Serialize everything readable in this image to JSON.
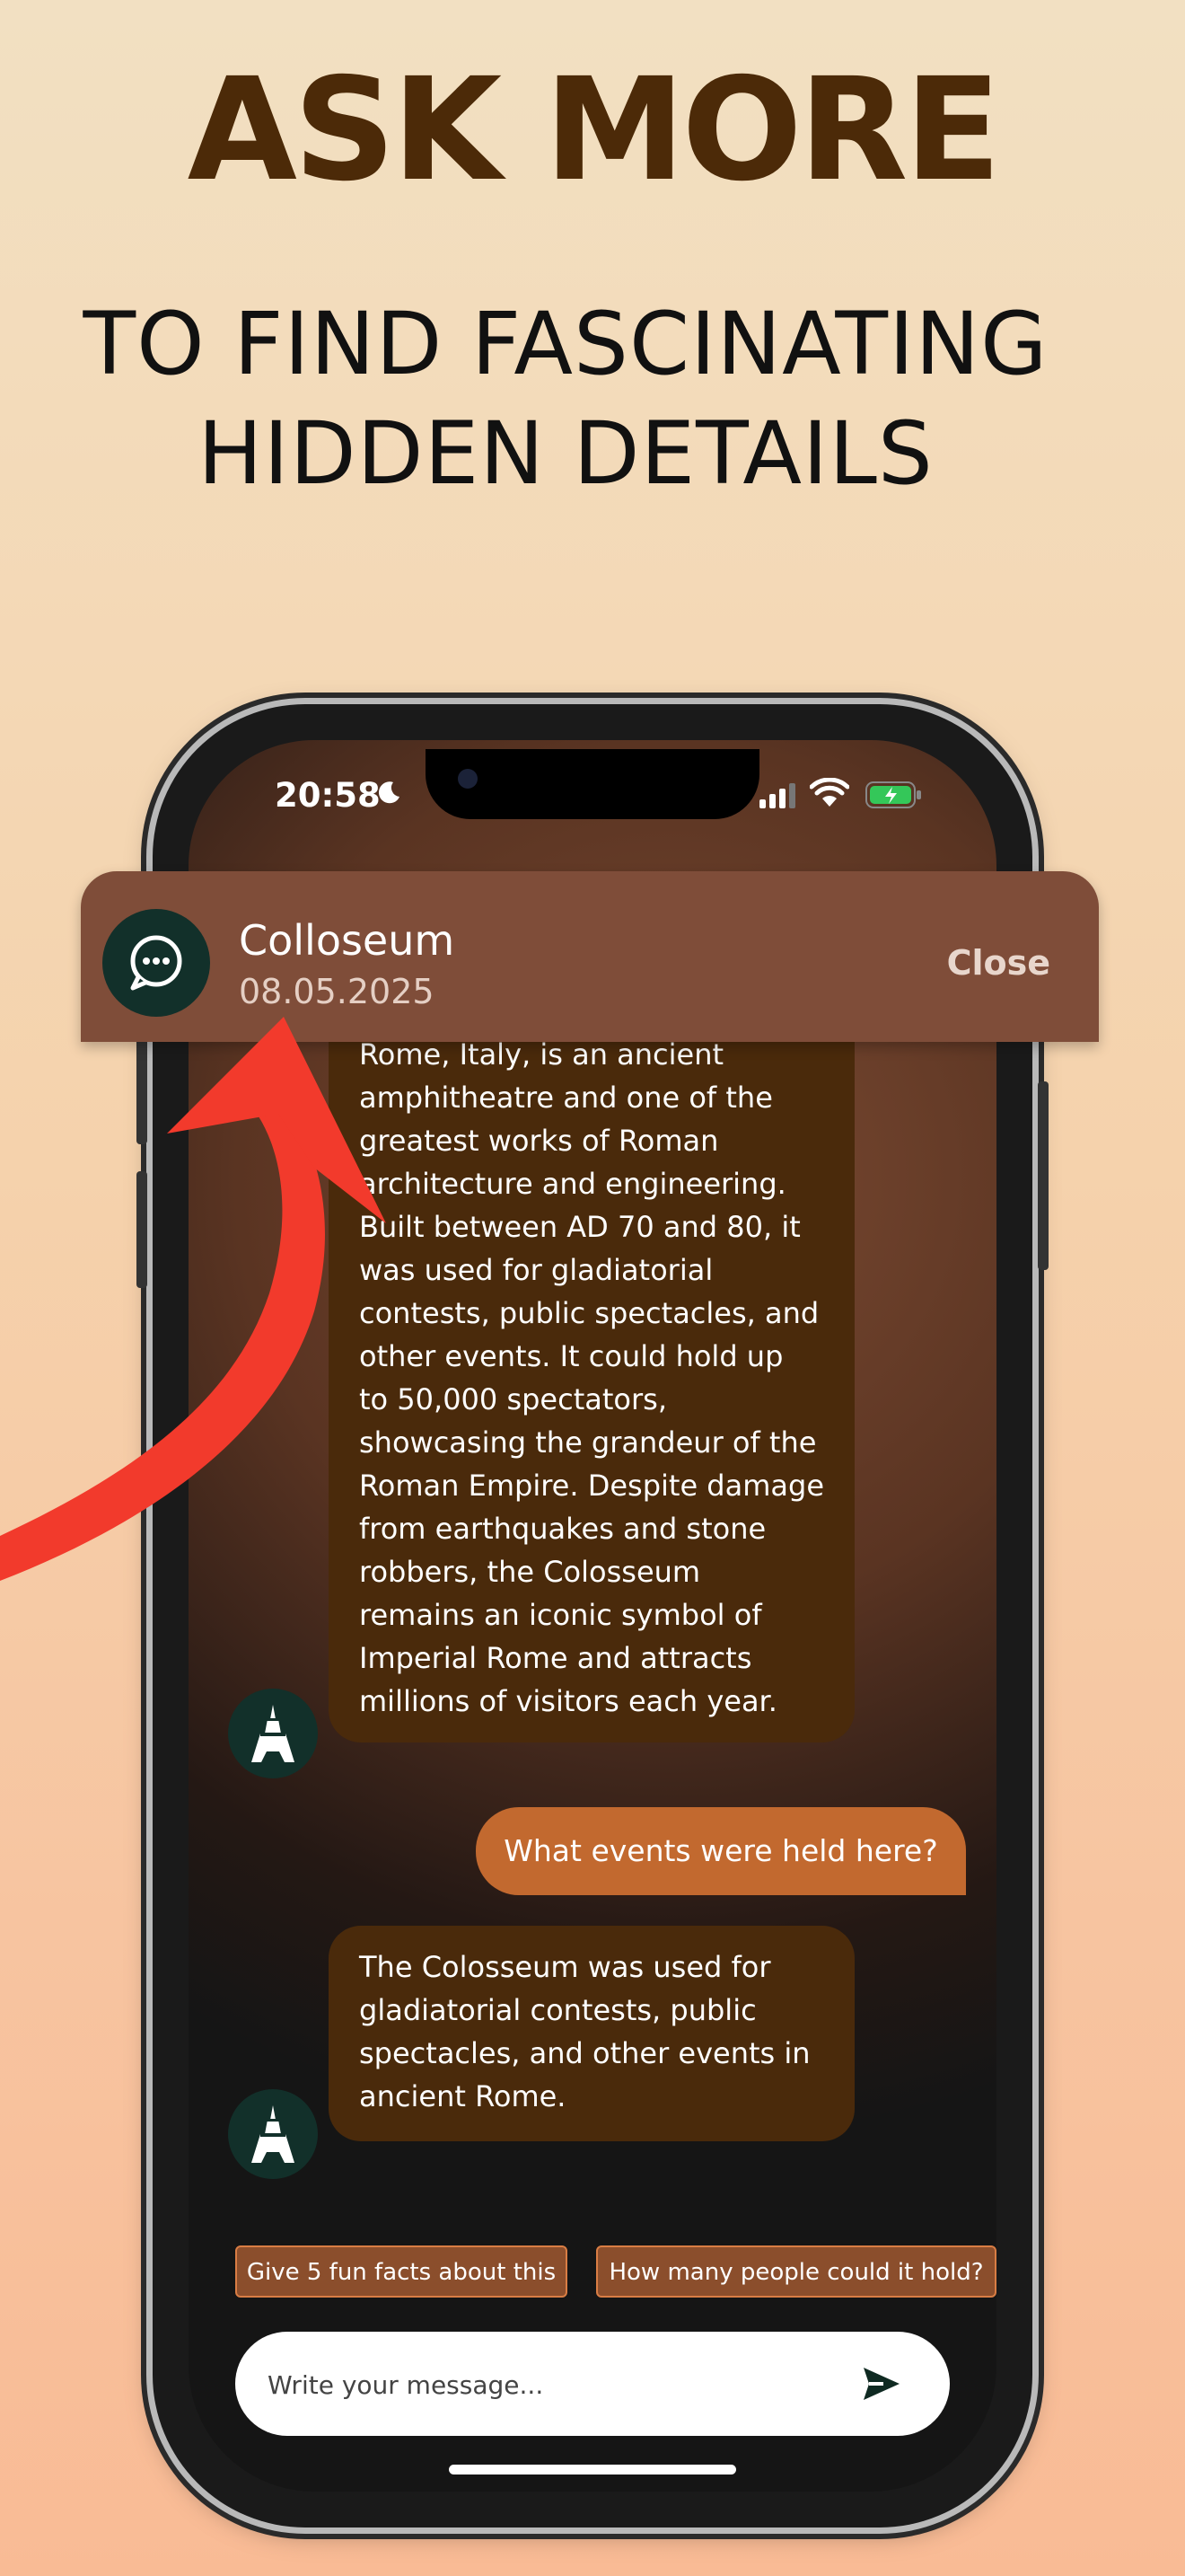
{
  "promo": {
    "headline": "ASK MORE",
    "subline_1": "TO FIND FASCINATING",
    "subline_2": "HIDDEN DETAILS"
  },
  "status_bar": {
    "time": "20:58"
  },
  "chat_header": {
    "title": "Colloseum",
    "date": "08.05.2025",
    "close_label": "Close"
  },
  "messages": [
    {
      "role": "assistant",
      "lines": [
        "Rome, Italy, is an ancient",
        "amphitheatre and one of the",
        "greatest works of Roman",
        "architecture and engineering.",
        "Built between AD 70 and 80, it",
        "was used for gladiatorial",
        "contests, public spectacles, and",
        "other events. It could hold up",
        "to 50,000 spectators,",
        "showcasing the grandeur of the",
        "Roman Empire. Despite damage",
        "from earthquakes and stone",
        "robbers, the Colosseum",
        "remains an iconic symbol of",
        "Imperial Rome and attracts",
        "millions of visitors each year."
      ]
    },
    {
      "role": "user",
      "text": "What events were held here?"
    },
    {
      "role": "assistant",
      "lines": [
        "The Colosseum was used for",
        "gladiatorial contests, public",
        "spectacles, and other events in",
        "ancient Rome."
      ]
    }
  ],
  "suggestions": [
    "Give 5 fun facts about this",
    "How many people could it hold?"
  ],
  "composer": {
    "placeholder": "Write your message..."
  },
  "icons": {
    "header_avatar": "chat-bubble-icon",
    "bot_avatar": "eiffel-tower-icon",
    "send": "send-icon",
    "arrow": "red-arrow"
  },
  "colors": {
    "headline": "#4c2a08",
    "bot_bubble": "#4a2a0b",
    "user_bubble": "#c2692f",
    "header_card": "#7f4d39",
    "arrow": "#f23a2c"
  }
}
